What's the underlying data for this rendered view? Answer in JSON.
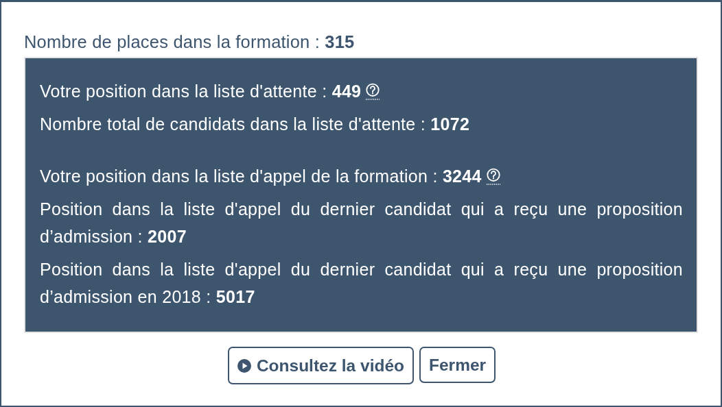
{
  "summary": "Nombre de places dans la formation : **315**",
  "panel": {
    "groups": [
      [
        {
          "text": "Votre position dans la liste d'attente : **449**",
          "help": true
        },
        {
          "text": "Nombre total de candidats dans la liste d'attente : **1072**",
          "help": false
        }
      ],
      [
        {
          "text": "Votre position dans la liste d'appel de la formation : **3244**",
          "help": true
        },
        {
          "text": "Position dans la liste d'appel du dernier candidat qui a reçu une proposition d’admission : **2007**",
          "help": false
        },
        {
          "text": "Position dans la liste d'appel du dernier candidat qui a reçu une proposition d’admission en 2018 : **5017**",
          "help": false
        }
      ]
    ]
  },
  "buttons": [
    {
      "label": "Consultez la vidéo",
      "kind": "video"
    },
    {
      "label": "Fermer",
      "kind": "plain"
    }
  ]
}
